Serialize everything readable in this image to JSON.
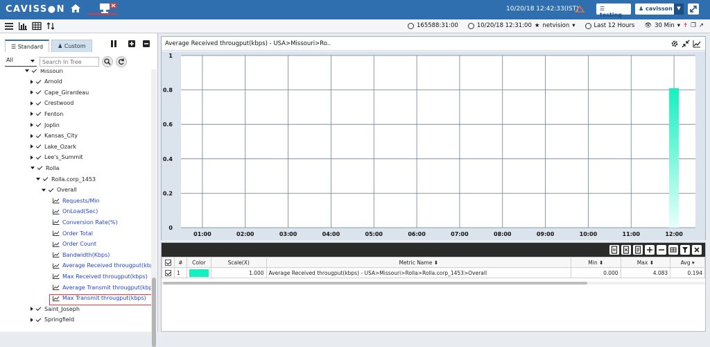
{
  "app": {
    "logo": "CAVISS●N",
    "datetime": "10/20/18 12:42:33(IST)",
    "testing_label": "testing",
    "user_label": "cavisson"
  },
  "toolbar": {
    "session_id": "165588:31:00",
    "start_time": "10/20/18 12:31:00",
    "profile": "netvision",
    "duration": "Last 12 Hours",
    "view_interval": "30 Min"
  },
  "tree_panel": {
    "tabs": [
      {
        "label": "Standard"
      },
      {
        "label": "Custom"
      }
    ],
    "filter_value": "All",
    "search_placeholder": "Search In Tree",
    "nodes": [
      {
        "label": "Missouri",
        "depth": 1,
        "expanded": true
      },
      {
        "label": "Arnold",
        "depth": 2
      },
      {
        "label": "Cape_Girardeau",
        "depth": 2
      },
      {
        "label": "Crestwood",
        "depth": 2
      },
      {
        "label": "Fenton",
        "depth": 2
      },
      {
        "label": "Joplin",
        "depth": 2
      },
      {
        "label": "Kansas_City",
        "depth": 2
      },
      {
        "label": "Lake_Ozark",
        "depth": 2
      },
      {
        "label": "Lee's_Summit",
        "depth": 2
      },
      {
        "label": "Rolla",
        "depth": 2,
        "expanded": true
      },
      {
        "label": "Rolla.corp_1453",
        "depth": 3,
        "expanded": true
      },
      {
        "label": "Overall",
        "depth": 4,
        "expanded": true
      },
      {
        "label": "Requests/Min",
        "depth": 5,
        "metric": true
      },
      {
        "label": "OnLoad(Sec)",
        "depth": 5,
        "metric": true
      },
      {
        "label": "Conversion Rate(%)",
        "depth": 5,
        "metric": true
      },
      {
        "label": "Order Total",
        "depth": 5,
        "metric": true
      },
      {
        "label": "Order Count",
        "depth": 5,
        "metric": true
      },
      {
        "label": "Bandwidth(Kbps)",
        "depth": 5,
        "metric": true
      },
      {
        "label": "Average Received througput(kbps)",
        "depth": 5,
        "metric": true,
        "selected": true
      },
      {
        "label": "Max Received througput(kbps)",
        "depth": 5,
        "metric": true
      },
      {
        "label": "Average Transmit througput(kbps)",
        "depth": 5,
        "metric": true
      },
      {
        "label": "Max Transmit througput(kbps)",
        "depth": 5,
        "metric": true
      },
      {
        "label": "Saint_Joseph",
        "depth": 2
      },
      {
        "label": "Springfield",
        "depth": 2
      }
    ]
  },
  "chart_panel": {
    "title": "Average Received througput(kbps) - USA>Missouri>Ro.."
  },
  "chart_data": {
    "type": "bar",
    "x": [
      "01:00",
      "02:00",
      "03:00",
      "04:00",
      "05:00",
      "06:00",
      "07:00",
      "08:00",
      "09:00",
      "10:00",
      "11:00",
      "12:00"
    ],
    "ytick_labels": [
      "0",
      "0.2",
      "0.4",
      "0.6",
      "0.8",
      "1"
    ],
    "ylim": [
      0,
      1
    ],
    "series": [
      {
        "color": "#14f0c0",
        "points": [
          {
            "x": "12:00",
            "y": 0.81
          }
        ]
      }
    ],
    "grid": true,
    "colors": {
      "bar_top": "#14f0c0",
      "bar_bottom": "#e6fffa",
      "plot_bg": "#ffffff",
      "outer_bg": "#dbe3ec",
      "grid": "#6b7f99"
    }
  },
  "grid_panel": {
    "columns": [
      "#",
      "Color",
      "Scale(X)",
      "Metric Name",
      "Min",
      "Max",
      "Avg"
    ],
    "rows": [
      {
        "num": "1",
        "color": "#14f0c0",
        "scale": "1.000",
        "metric_name": "Average Received througput(kbps) - USA>Missouri>Rolla>Rolla.corp_1453>Overall",
        "min": "0.000",
        "max": "4.083",
        "avg": "0.194"
      }
    ]
  }
}
